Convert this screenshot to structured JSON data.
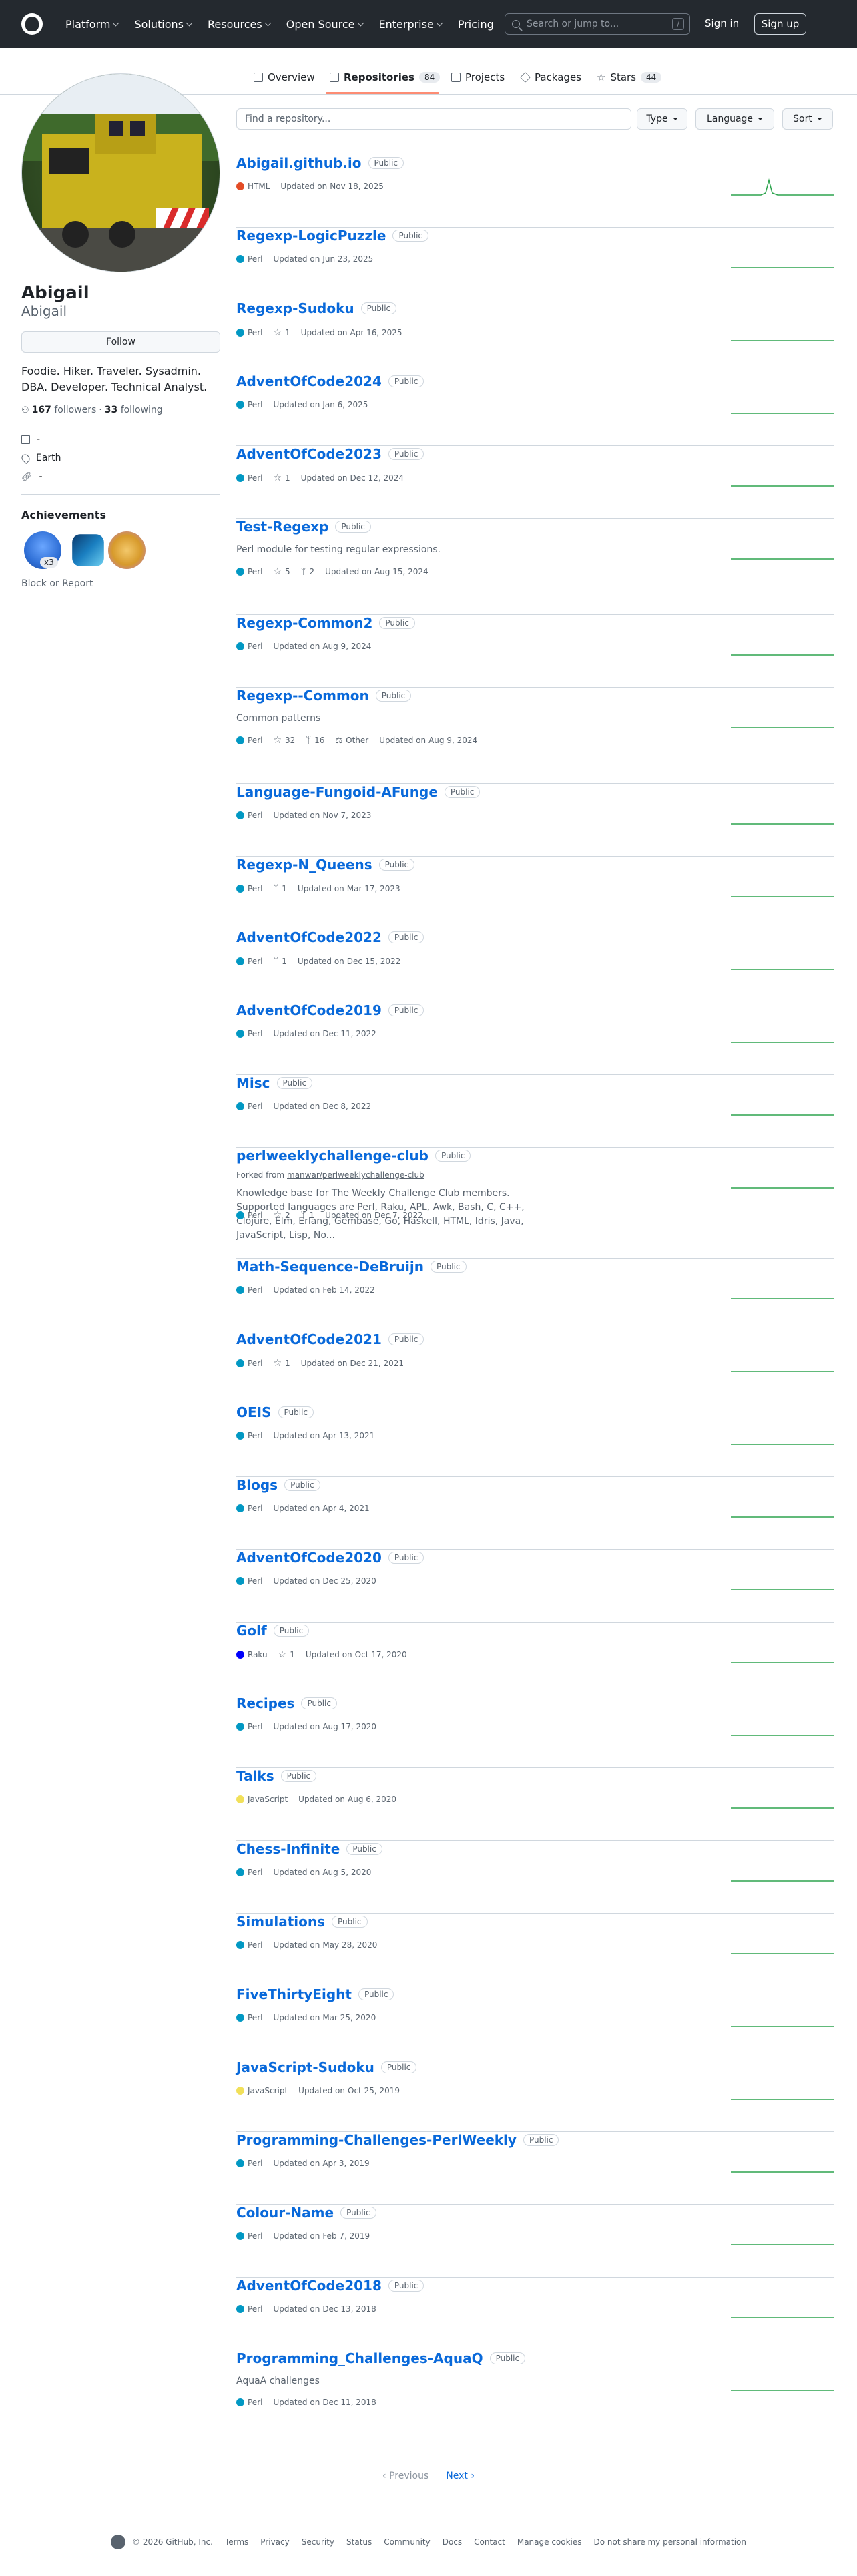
{
  "header": {
    "nav": [
      "Platform",
      "Solutions",
      "Resources",
      "Open Source",
      "Enterprise",
      "Pricing"
    ],
    "search_placeholder": "Search or jump to...",
    "search_key": "/",
    "signin": "Sign in",
    "signup": "Sign up"
  },
  "tabs": [
    {
      "label": "Overview",
      "count": ""
    },
    {
      "label": "Repositories",
      "count": "84"
    },
    {
      "label": "Projects",
      "count": ""
    },
    {
      "label": "Packages",
      "count": ""
    },
    {
      "label": "Stars",
      "count": "44"
    }
  ],
  "profile": {
    "full_name": "Abigail",
    "login": "Abigail",
    "follow": "Follow",
    "bio": "Foodie. Hiker. Traveler. Sysadmin. DBA. Developer. Technical Analyst.",
    "followers_count": "167",
    "followers_label": "followers",
    "sep": "·",
    "following_count": "33",
    "following_label": "following",
    "company": "-",
    "location": "Earth",
    "website": "-",
    "achievements_title": "Achievements",
    "badge_count": "x3",
    "block_report": "Block or Report"
  },
  "filters": {
    "find_placeholder": "Find a repository...",
    "type": "Type",
    "language": "Language",
    "sort": "Sort"
  },
  "colors": {
    "Perl": "#0298c3",
    "HTML": "#e34c26",
    "Raku": "#0000fb",
    "JavaScript": "#f1e05a",
    "link": "#0969da",
    "spark": "#2da44e"
  },
  "public_label": "Public",
  "updated_prefix": "Updated on",
  "repos": [
    {
      "name": "Abigail.github.io",
      "lang": "HTML",
      "updated": "Nov 18, 2025",
      "peak": true
    },
    {
      "name": "Regexp-LogicPuzzle",
      "lang": "Perl",
      "updated": "Jun 23, 2025"
    },
    {
      "name": "Regexp-Sudoku",
      "lang": "Perl",
      "stars": "1",
      "updated": "Apr 16, 2025"
    },
    {
      "name": "AdventOfCode2024",
      "lang": "Perl",
      "updated": "Jan 6, 2025"
    },
    {
      "name": "AdventOfCode2023",
      "lang": "Perl",
      "stars": "1",
      "updated": "Dec 12, 2024"
    },
    {
      "name": "Test-Regexp",
      "desc": "Perl module for testing regular expressions.",
      "lang": "Perl",
      "stars": "5",
      "forks": "2",
      "updated": "Aug 15, 2024"
    },
    {
      "name": "Regexp-Common2",
      "lang": "Perl",
      "updated": "Aug 9, 2024"
    },
    {
      "name": "Regexp--Common",
      "desc": "Common patterns",
      "lang": "Perl",
      "stars": "32",
      "forks": "16",
      "license": "Other",
      "updated": "Aug 9, 2024"
    },
    {
      "name": "Language-Fungoid-AFunge",
      "lang": "Perl",
      "updated": "Nov 7, 2023"
    },
    {
      "name": "Regexp-N_Queens",
      "lang": "Perl",
      "forks": "1",
      "updated": "Mar 17, 2023"
    },
    {
      "name": "AdventOfCode2022",
      "lang": "Perl",
      "forks": "1",
      "updated": "Dec 15, 2022"
    },
    {
      "name": "AdventOfCode2019",
      "lang": "Perl",
      "updated": "Dec 11, 2022"
    },
    {
      "name": "Misc",
      "lang": "Perl",
      "updated": "Dec 8, 2022"
    },
    {
      "name": "perlweeklychallenge-club",
      "forked_label": "Forked from",
      "forked_from": "manwar/perlweeklychallenge-club",
      "desc": "Knowledge base for The Weekly Challenge Club members. Supported languages are Perl, Raku, APL, Awk, Bash, C, C++, Clojure, Elm, Erlang, Gembase, Go, Haskell, HTML, Idris, Java, JavaScript, Lisp, No...",
      "lang": "Perl",
      "stars": "2",
      "forks": "1",
      "updated": "Dec 7, 2022"
    },
    {
      "name": "Math-Sequence-DeBruijn",
      "lang": "Perl",
      "updated": "Feb 14, 2022"
    },
    {
      "name": "AdventOfCode2021",
      "lang": "Perl",
      "stars": "1",
      "updated": "Dec 21, 2021"
    },
    {
      "name": "OEIS",
      "lang": "Perl",
      "updated": "Apr 13, 2021"
    },
    {
      "name": "Blogs",
      "lang": "Perl",
      "updated": "Apr 4, 2021"
    },
    {
      "name": "AdventOfCode2020",
      "lang": "Perl",
      "updated": "Dec 25, 2020"
    },
    {
      "name": "Golf",
      "lang": "Raku",
      "stars": "1",
      "updated": "Oct 17, 2020"
    },
    {
      "name": "Recipes",
      "lang": "Perl",
      "updated": "Aug 17, 2020"
    },
    {
      "name": "Talks",
      "lang": "JavaScript",
      "updated": "Aug 6, 2020"
    },
    {
      "name": "Chess-Infinite",
      "lang": "Perl",
      "updated": "Aug 5, 2020"
    },
    {
      "name": "Simulations",
      "lang": "Perl",
      "updated": "May 28, 2020"
    },
    {
      "name": "FiveThirtyEight",
      "lang": "Perl",
      "updated": "Mar 25, 2020"
    },
    {
      "name": "JavaScript-Sudoku",
      "lang": "JavaScript",
      "updated": "Oct 25, 2019"
    },
    {
      "name": "Programming-Challenges-PerlWeekly",
      "lang": "Perl",
      "updated": "Apr 3, 2019"
    },
    {
      "name": "Colour-Name",
      "lang": "Perl",
      "updated": "Feb 7, 2019"
    },
    {
      "name": "AdventOfCode2018",
      "lang": "Perl",
      "updated": "Dec 13, 2018"
    },
    {
      "name": "Programming_Challenges-AquaQ",
      "desc": "AquaA challenges",
      "lang": "Perl",
      "updated": "Dec 11, 2018"
    }
  ],
  "pagination": {
    "previous": "Previous",
    "next": "Next"
  },
  "footer": {
    "copyright": "© 2026 GitHub, Inc.",
    "links": [
      "Terms",
      "Privacy",
      "Security",
      "Status",
      "Community",
      "Docs",
      "Contact",
      "Manage cookies",
      "Do not share my personal information"
    ]
  }
}
